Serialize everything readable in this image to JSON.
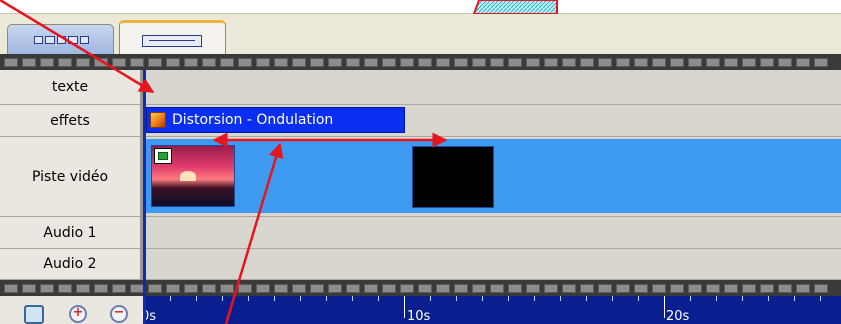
{
  "tabs": [
    {
      "name": "storyboard",
      "icon": "storyboard-view-icon"
    },
    {
      "name": "timeline",
      "icon": "timeline-view-icon",
      "active": true
    }
  ],
  "tracks": {
    "text_label": "texte",
    "effects_label": "effets",
    "video_label": "Piste vidéo",
    "audio1_label": "Audio 1",
    "audio2_label": "Audio 2"
  },
  "effect_clip": {
    "label": "Distorsion - Ondulation",
    "icon": "effect-icon"
  },
  "video_clips": [
    {
      "icon": "sunset-thumbnail"
    },
    {
      "icon": "black-thumbnail"
    }
  ],
  "toolbar": {
    "icons": [
      "fit-to-window-icon",
      "zoom-in-icon",
      "zoom-out-icon"
    ],
    "zoom_in_symbol": "+",
    "zoom_out_symbol": "−"
  },
  "ruler": {
    "labels": [
      "0s",
      "10s",
      "20s"
    ]
  },
  "colors": {
    "annotation": "#e8141e",
    "clip_blue": "#0a2ef2",
    "video_band": "#3e9af0",
    "ruler_bg": "#0a1f8f",
    "playhead": "#0b2cb3"
  }
}
